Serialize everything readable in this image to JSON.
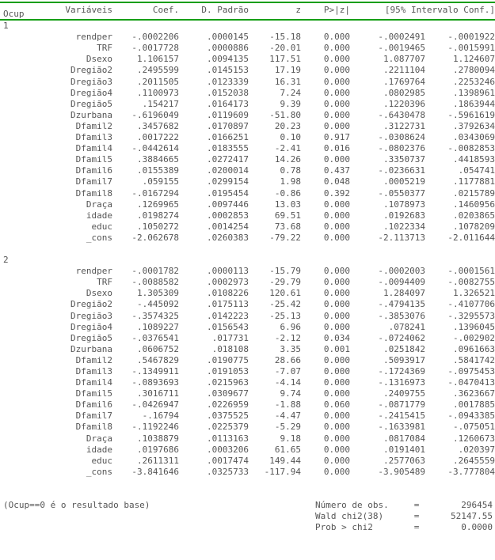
{
  "header": {
    "ocup": "Ocup",
    "variables": "Variáveis",
    "coef": "Coef.",
    "se": "D. Padrão",
    "z": "z",
    "p": "P>|z|",
    "ci": "[95% Intervalo Conf.]"
  },
  "groups": [
    {
      "label": "1",
      "rows": [
        {
          "var": "rendper",
          "coef": "-.0002206",
          "se": ".0000145",
          "z": "-15.18",
          "p": "0.000",
          "lo": "-.0002491",
          "hi": "-.0001922"
        },
        {
          "var": "TRF",
          "coef": "-.0017728",
          "se": ".0000886",
          "z": "-20.01",
          "p": "0.000",
          "lo": "-.0019465",
          "hi": "-.0015991"
        },
        {
          "var": "Dsexo",
          "coef": "1.106157",
          "se": ".0094135",
          "z": "117.51",
          "p": "0.000",
          "lo": "1.087707",
          "hi": "1.124607"
        },
        {
          "var": "Dregião2",
          "coef": ".2495599",
          "se": ".0145153",
          "z": "17.19",
          "p": "0.000",
          "lo": ".2211104",
          "hi": ".2780094"
        },
        {
          "var": "Dregião3",
          "coef": ".2011505",
          "se": ".0123339",
          "z": "16.31",
          "p": "0.000",
          "lo": ".1769764",
          "hi": ".2253246"
        },
        {
          "var": "Dregião4",
          "coef": ".1100973",
          "se": ".0152038",
          "z": "7.24",
          "p": "0.000",
          "lo": ".0802985",
          "hi": ".1398961"
        },
        {
          "var": "Dregião5",
          "coef": ".154217",
          "se": ".0164173",
          "z": "9.39",
          "p": "0.000",
          "lo": ".1220396",
          "hi": ".1863944"
        },
        {
          "var": "Dzurbana",
          "coef": "-.6196049",
          "se": ".0119609",
          "z": "-51.80",
          "p": "0.000",
          "lo": "-.6430478",
          "hi": "-.5961619"
        },
        {
          "var": "Dfamil2",
          "coef": ".3457682",
          "se": ".0170897",
          "z": "20.23",
          "p": "0.000",
          "lo": ".3122731",
          "hi": ".3792634"
        },
        {
          "var": "Dfamil3",
          "coef": ".0017222",
          "se": ".0166251",
          "z": "0.10",
          "p": "0.917",
          "lo": "-.0308624",
          "hi": ".0343069"
        },
        {
          "var": "Dfamil4",
          "coef": "-.0442614",
          "se": ".0183555",
          "z": "-2.41",
          "p": "0.016",
          "lo": "-.0802376",
          "hi": "-.0082853"
        },
        {
          "var": "Dfamil5",
          "coef": ".3884665",
          "se": ".0272417",
          "z": "14.26",
          "p": "0.000",
          "lo": ".3350737",
          "hi": ".4418593"
        },
        {
          "var": "Dfamil6",
          "coef": ".0155389",
          "se": ".0200014",
          "z": "0.78",
          "p": "0.437",
          "lo": "-.0236631",
          "hi": ".054741"
        },
        {
          "var": "Dfamil7",
          "coef": ".059155",
          "se": ".0299154",
          "z": "1.98",
          "p": "0.048",
          "lo": ".0005219",
          "hi": ".1177881"
        },
        {
          "var": "Dfamil8",
          "coef": "-.0167294",
          "se": ".0195454",
          "z": "-0.86",
          "p": "0.392",
          "lo": "-.0550377",
          "hi": ".0215789"
        },
        {
          "var": "Draça",
          "coef": ".1269965",
          "se": ".0097446",
          "z": "13.03",
          "p": "0.000",
          "lo": ".1078973",
          "hi": ".1460956"
        },
        {
          "var": "idade",
          "coef": ".0198274",
          "se": ".0002853",
          "z": "69.51",
          "p": "0.000",
          "lo": ".0192683",
          "hi": ".0203865"
        },
        {
          "var": "educ",
          "coef": ".1050272",
          "se": ".0014254",
          "z": "73.68",
          "p": "0.000",
          "lo": ".1022334",
          "hi": ".1078209"
        },
        {
          "var": "_cons",
          "coef": "-2.062678",
          "se": ".0260383",
          "z": "-79.22",
          "p": "0.000",
          "lo": "-2.113713",
          "hi": "-2.011644"
        }
      ]
    },
    {
      "label": "2",
      "rows": [
        {
          "var": "rendper",
          "coef": "-.0001782",
          "se": ".0000113",
          "z": "-15.79",
          "p": "0.000",
          "lo": "-.0002003",
          "hi": "-.0001561"
        },
        {
          "var": "TRF",
          "coef": "-.0088582",
          "se": ".0002973",
          "z": "-29.79",
          "p": "0.000",
          "lo": "-.0094409",
          "hi": "-.0082755"
        },
        {
          "var": "Dsexo",
          "coef": "1.305309",
          "se": ".0108226",
          "z": "120.61",
          "p": "0.000",
          "lo": "1.284097",
          "hi": "1.326521"
        },
        {
          "var": "Dregião2",
          "coef": "-.445092",
          "se": ".0175113",
          "z": "-25.42",
          "p": "0.000",
          "lo": "-.4794135",
          "hi": "-.4107706"
        },
        {
          "var": "Dregião3",
          "coef": "-.3574325",
          "se": ".0142223",
          "z": "-25.13",
          "p": "0.000",
          "lo": "-.3853076",
          "hi": "-.3295573"
        },
        {
          "var": "Dregião4",
          "coef": ".1089227",
          "se": ".0156543",
          "z": "6.96",
          "p": "0.000",
          "lo": ".078241",
          "hi": ".1396045"
        },
        {
          "var": "Dregião5",
          "coef": "-.0376541",
          "se": ".017731",
          "z": "-2.12",
          "p": "0.034",
          "lo": "-.0724062",
          "hi": "-.002902"
        },
        {
          "var": "Dzurbana",
          "coef": ".0606752",
          "se": ".018108",
          "z": "3.35",
          "p": "0.001",
          "lo": ".0251842",
          "hi": ".0961663"
        },
        {
          "var": "Dfamil2",
          "coef": ".5467829",
          "se": ".0190775",
          "z": "28.66",
          "p": "0.000",
          "lo": ".5093917",
          "hi": ".5841742"
        },
        {
          "var": "Dfamil3",
          "coef": "-.1349911",
          "se": ".0191053",
          "z": "-7.07",
          "p": "0.000",
          "lo": "-.1724369",
          "hi": "-.0975453"
        },
        {
          "var": "Dfamil4",
          "coef": "-.0893693",
          "se": ".0215963",
          "z": "-4.14",
          "p": "0.000",
          "lo": "-.1316973",
          "hi": "-.0470413"
        },
        {
          "var": "Dfamil5",
          "coef": ".3016711",
          "se": ".0309677",
          "z": "9.74",
          "p": "0.000",
          "lo": ".2409755",
          "hi": ".3623667"
        },
        {
          "var": "Dfamil6",
          "coef": "-.0426947",
          "se": ".0226959",
          "z": "-1.88",
          "p": "0.060",
          "lo": "-.0871779",
          "hi": ".0017885"
        },
        {
          "var": "Dfamil7",
          "coef": "-.16794",
          "se": ".0375525",
          "z": "-4.47",
          "p": "0.000",
          "lo": "-.2415415",
          "hi": "-.0943385"
        },
        {
          "var": "Dfamil8",
          "coef": "-.1192246",
          "se": ".0225379",
          "z": "-5.29",
          "p": "0.000",
          "lo": "-.1633981",
          "hi": "-.075051"
        },
        {
          "var": "Draça",
          "coef": ".1038879",
          "se": ".0113163",
          "z": "9.18",
          "p": "0.000",
          "lo": ".0817084",
          "hi": ".1260673"
        },
        {
          "var": "idade",
          "coef": ".0197686",
          "se": ".0003206",
          "z": "61.65",
          "p": "0.000",
          "lo": ".0191401",
          "hi": ".020397"
        },
        {
          "var": "educ",
          "coef": ".2611311",
          "se": ".0017474",
          "z": "149.44",
          "p": "0.000",
          "lo": ".2577063",
          "hi": ".2645559"
        },
        {
          "var": "_cons",
          "coef": "-3.841646",
          "se": ".0325733",
          "z": "-117.94",
          "p": "0.000",
          "lo": "-3.905489",
          "hi": "-3.777804"
        }
      ]
    }
  ],
  "footer": {
    "base_note": "(Ocup==0 é o resultado base)",
    "stats": [
      {
        "label": "Número de obs.",
        "eq": "=",
        "value": "296454"
      },
      {
        "label": "Wald chi2(38)",
        "eq": "=",
        "value": "52147.55"
      },
      {
        "label": "Prob > chi2",
        "eq": "=",
        "value": "0.0000"
      }
    ]
  },
  "colors": {
    "rule": "#169e16",
    "text": "#555555",
    "background": "#ffffff"
  }
}
